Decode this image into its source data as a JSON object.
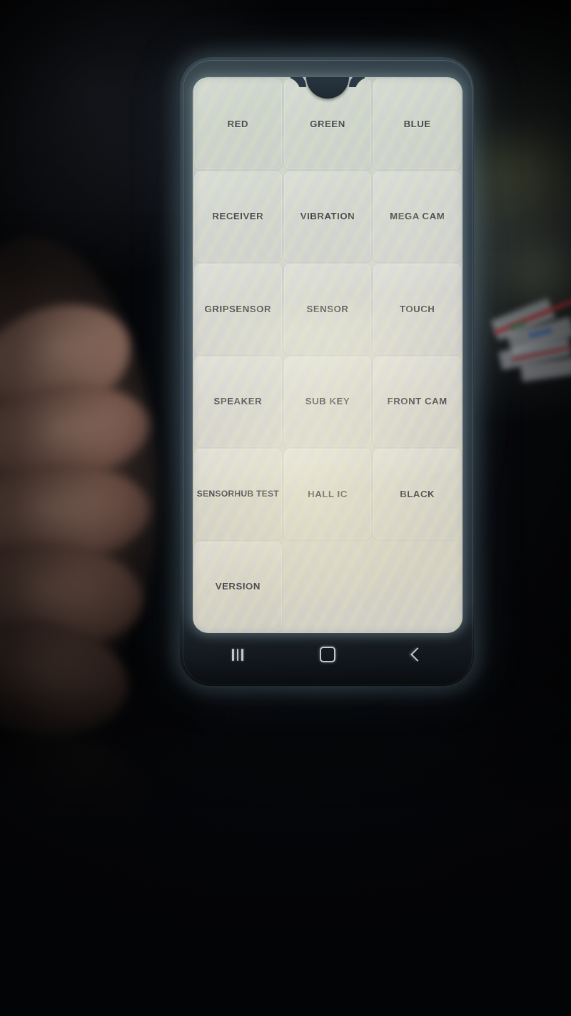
{
  "app": {
    "title": "Hardware Test Menu",
    "device": "Samsung smartphone",
    "screen_tint": "#d2d4cd",
    "bezel_color": "#2c3a46",
    "label_color": "#3c3e3e"
  },
  "grid": {
    "columns": 3,
    "rows": 6,
    "buttons": [
      {
        "label": "RED"
      },
      {
        "label": "GREEN"
      },
      {
        "label": "BLUE"
      },
      {
        "label": "RECEIVER"
      },
      {
        "label": "VIBRATION"
      },
      {
        "label": "MEGA CAM"
      },
      {
        "label": "GRIPSENSOR"
      },
      {
        "label": "SENSOR"
      },
      {
        "label": "TOUCH"
      },
      {
        "label": "SPEAKER"
      },
      {
        "label": "SUB KEY"
      },
      {
        "label": "FRONT CAM"
      },
      {
        "label": "SENSORHUB TEST"
      },
      {
        "label": "HALL IC"
      },
      {
        "label": "BLACK"
      },
      {
        "label": "VERSION"
      }
    ]
  },
  "navbar": {
    "recents_label": "Recents",
    "home_label": "Home",
    "back_label": "Back"
  }
}
